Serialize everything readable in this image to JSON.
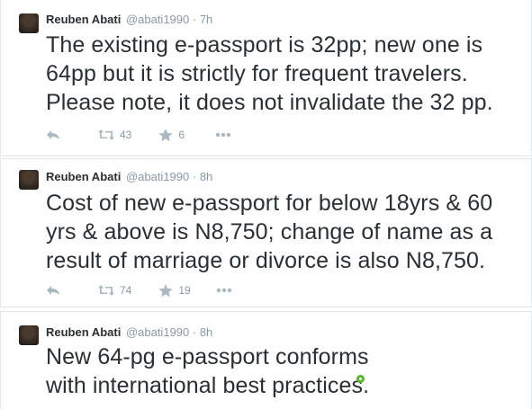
{
  "tweets": [
    {
      "name": "Reuben Abati",
      "handle": "@abati1990",
      "time": "· 7h",
      "text": "The existing e-passport is 32pp; new one is 64pp but it is strictly for frequent travelers. Please note, it does not invalidate the 32 pp.",
      "retweets": "43",
      "favorites": "6"
    },
    {
      "name": "Reuben Abati",
      "handle": "@abati1990",
      "time": "· 8h",
      "text": "Cost of new e-passport for below 18yrs & 60 yrs & above is N8,750; change of name as a result of marriage or divorce is also N8,750.",
      "retweets": "74",
      "favorites": "19"
    },
    {
      "name": "Reuben Abati",
      "handle": "@abati1990",
      "time": "· 8h",
      "text": "New 64-pg e-passport conforms with international best practices."
    }
  ],
  "icons": {
    "reply": "reply-icon",
    "retweet": "retweet-icon",
    "favorite": "star-icon",
    "more": "more-icon"
  },
  "colors": {
    "text": "#292f33",
    "muted": "#8899a6",
    "icon": "#aab8c2",
    "border": "#e1e8ed",
    "status_dot": "#5ab22f"
  }
}
